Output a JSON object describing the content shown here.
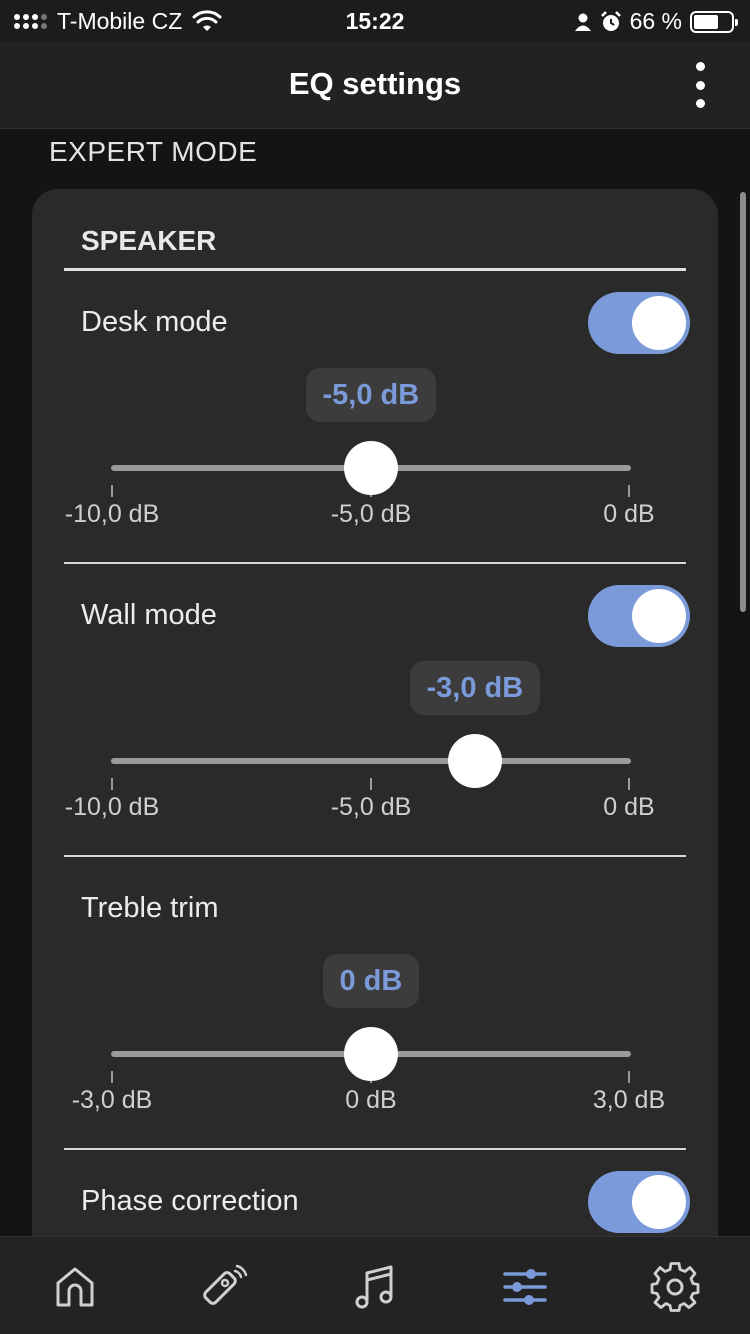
{
  "status_bar": {
    "carrier": "T-Mobile CZ",
    "time": "15:22",
    "battery": "66 %",
    "battery_level": 0.66,
    "icons": [
      "signal-icon",
      "wifi-icon",
      "person-icon",
      "alarm-icon",
      "battery-icon"
    ]
  },
  "header": {
    "title": "EQ settings",
    "menu_icon": "more-vertical-icon"
  },
  "section_label": "EXPERT MODE",
  "card": {
    "title": "SPEAKER",
    "rows": [
      {
        "label": "Desk mode",
        "toggle_on": true,
        "value": "-5,0 dB",
        "slider_min": -10,
        "slider_max": 0,
        "slider_value": -5,
        "ticks": [
          "-10,0 dB",
          "-5,0 dB",
          "0 dB"
        ]
      },
      {
        "label": "Wall mode",
        "toggle_on": true,
        "value": "-3,0 dB",
        "slider_min": -10,
        "slider_max": 0,
        "slider_value": -3,
        "ticks": [
          "-10,0 dB",
          "-5,0 dB",
          "0 dB"
        ]
      },
      {
        "label": "Treble trim",
        "value": "0 dB",
        "slider_min": -3,
        "slider_max": 3,
        "slider_value": 0,
        "ticks": [
          "-3,0 dB",
          "0 dB",
          "3,0 dB"
        ]
      },
      {
        "label": "Phase correction",
        "toggle_on": true
      }
    ]
  },
  "bottom_nav": {
    "items": [
      {
        "icon": "home-icon",
        "active": false
      },
      {
        "icon": "remote-icon",
        "active": false
      },
      {
        "icon": "music-note-icon",
        "active": false
      },
      {
        "icon": "equalizer-icon",
        "active": true
      },
      {
        "icon": "gear-icon",
        "active": false
      }
    ]
  },
  "colors": {
    "accent": "#7b9ad9",
    "background": "#141414",
    "card": "#2a2a2a",
    "inactive_icon": "#d0d0d0"
  }
}
